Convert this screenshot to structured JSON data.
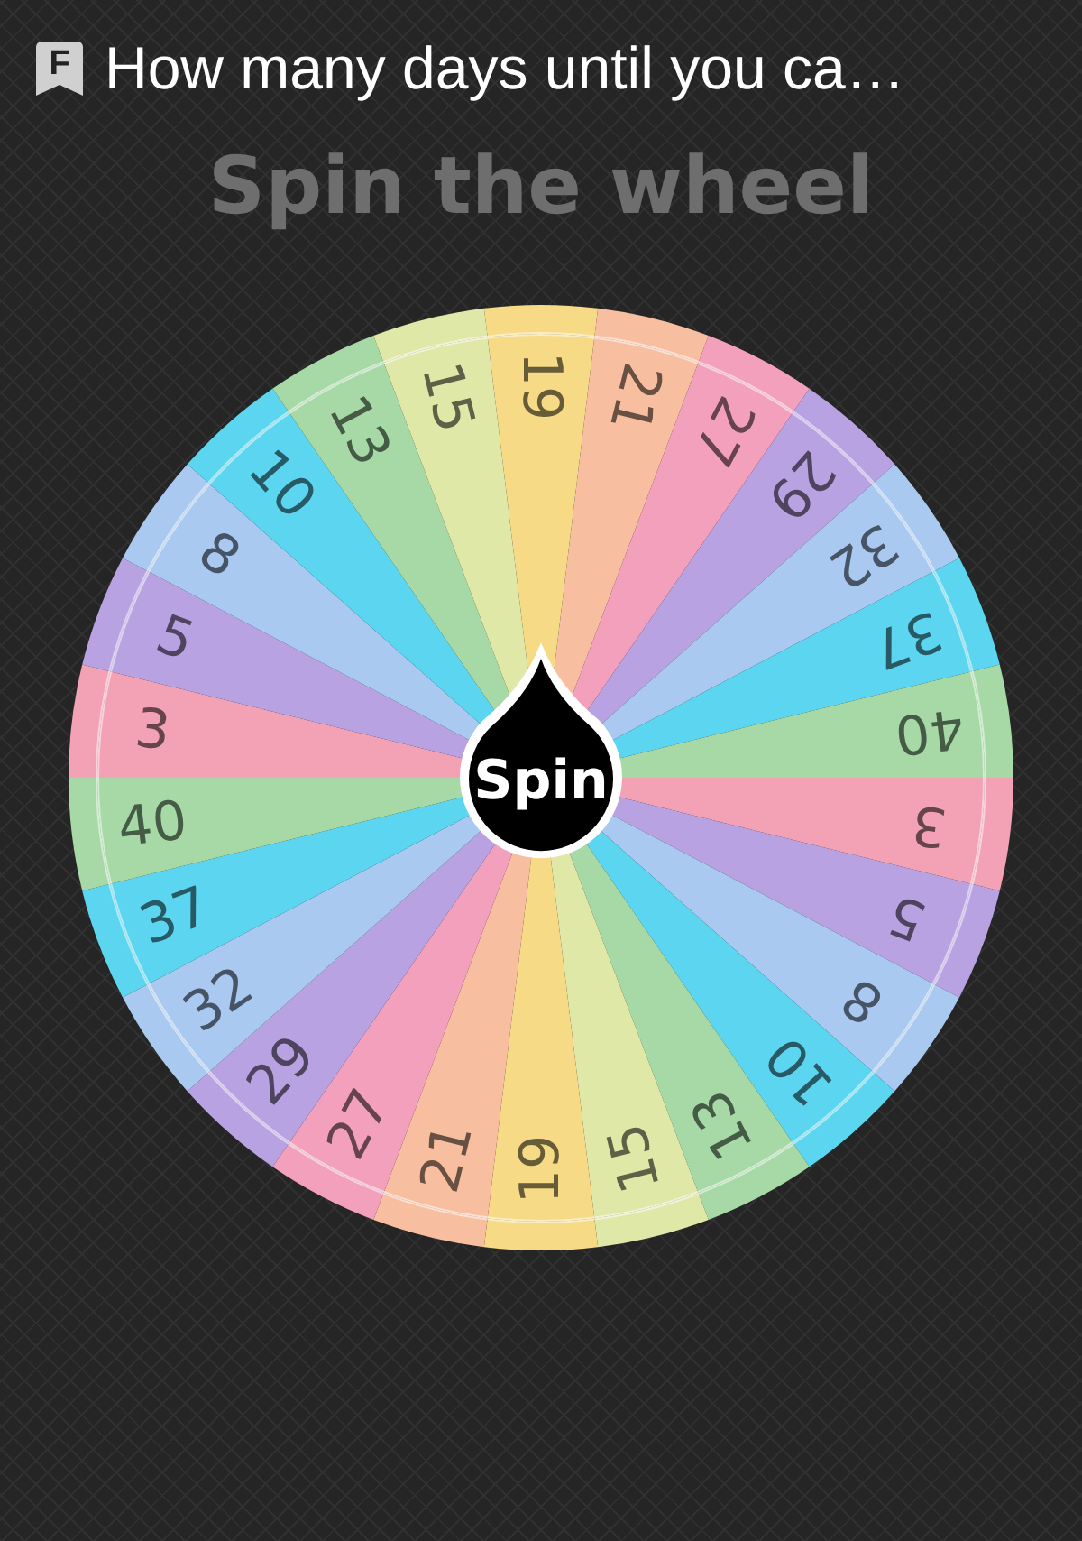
{
  "header": {
    "icon_letter": "F",
    "title": "How many days until you ca…"
  },
  "heading": "Spin the wheel",
  "wheel": {
    "button": "Spin",
    "segments": [
      {
        "label": "19",
        "color": "#f6da86"
      },
      {
        "label": "21",
        "color": "#f7bfa0"
      },
      {
        "label": "27",
        "color": "#f2a0bc"
      },
      {
        "label": "29",
        "color": "#b9a2e2"
      },
      {
        "label": "32",
        "color": "#a9c9f0"
      },
      {
        "label": "37",
        "color": "#5cd6f0"
      },
      {
        "label": "40",
        "color": "#a6d9a6"
      },
      {
        "label": "3",
        "color": "#f2a2b4"
      },
      {
        "label": "5",
        "color": "#b9a2e2"
      },
      {
        "label": "8",
        "color": "#a9c9f0"
      },
      {
        "label": "10",
        "color": "#5cd6f0"
      },
      {
        "label": "13",
        "color": "#a6d9a6"
      },
      {
        "label": "15",
        "color": "#e0e8a8"
      },
      {
        "label": "19",
        "color": "#f6da86"
      },
      {
        "label": "21",
        "color": "#f7bfa0"
      },
      {
        "label": "27",
        "color": "#f2a0bc"
      },
      {
        "label": "29",
        "color": "#b9a2e2"
      },
      {
        "label": "32",
        "color": "#a9c9f0"
      },
      {
        "label": "37",
        "color": "#5cd6f0"
      },
      {
        "label": "40",
        "color": "#a6d9a6"
      },
      {
        "label": "3",
        "color": "#f2a2b4"
      },
      {
        "label": "5",
        "color": "#b9a2e2"
      },
      {
        "label": "8",
        "color": "#a9c9f0"
      },
      {
        "label": "10",
        "color": "#5cd6f0"
      },
      {
        "label": "13",
        "color": "#a6d9a6"
      },
      {
        "label": "15",
        "color": "#e0e8a8"
      }
    ]
  }
}
